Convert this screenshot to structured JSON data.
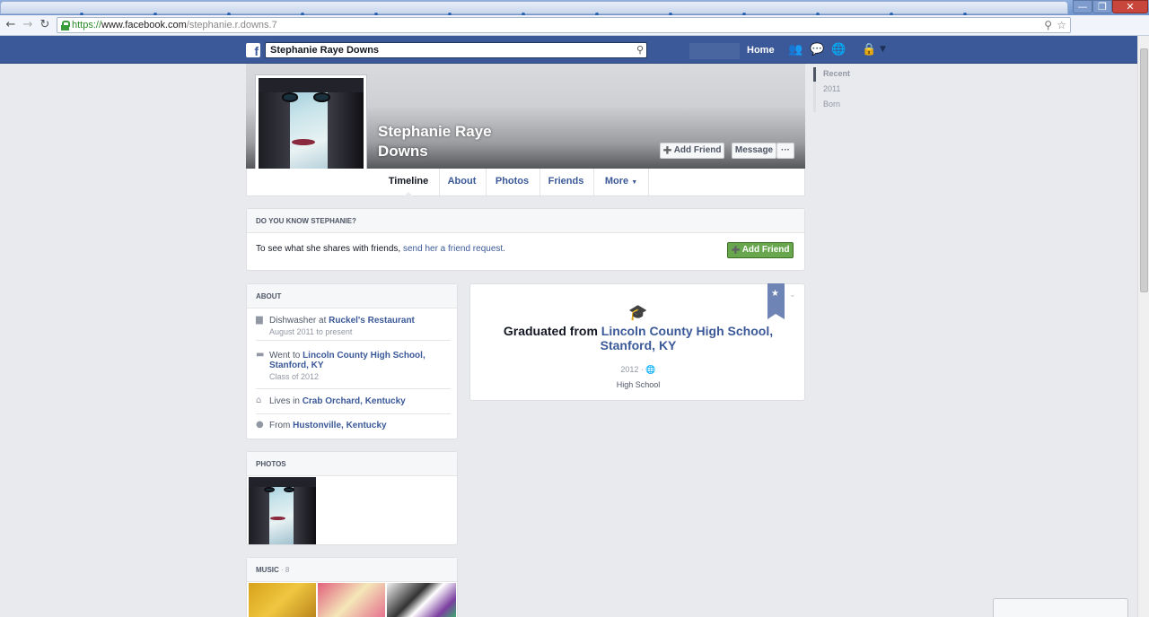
{
  "browser": {
    "url_protocol": "https://",
    "url_host": "www.facebook.com",
    "url_path": "/stephanie.r.downs.7",
    "window_buttons": [
      "—",
      "❐",
      "✕"
    ]
  },
  "fb_header": {
    "logo": "f",
    "search_value": "Stephanie Raye Downs",
    "home_label": "Home"
  },
  "profile": {
    "name_line1": "Stephanie Raye",
    "name_line2": "Downs",
    "add_friend_label": "Add Friend",
    "message_label": "Message",
    "more_actions_label": "···"
  },
  "tabs": {
    "timeline": "Timeline",
    "about": "About",
    "photos": "Photos",
    "friends": "Friends",
    "more": "More"
  },
  "know_card": {
    "heading": "DO YOU KNOW STEPHANIE?",
    "text": "To see what she shares with friends,",
    "link": "send her a friend request.",
    "button": "Add Friend"
  },
  "about": {
    "heading": "ABOUT",
    "work_prefix": "Dishwasher at ",
    "work_place": "Ruckel's Restaurant",
    "work_sub": "August 2011 to present",
    "school_prefix": "Went to ",
    "school_place": "Lincoln County High School, Stanford, KY",
    "school_sub": "Class of 2012",
    "lives_prefix": "Lives in ",
    "lives_place": "Crab Orchard, Kentucky",
    "from_prefix": "From ",
    "from_place": "Hustonville, Kentucky"
  },
  "photos_card": {
    "heading": "PHOTOS"
  },
  "music_card": {
    "heading": "MUSIC",
    "count": "· 8"
  },
  "event": {
    "prefix": "Graduated from ",
    "school": "Lincoln County High School, Stanford, KY",
    "year": "2012",
    "type": "High School"
  },
  "timeline_nav": {
    "items": [
      "Recent",
      "2011",
      "Born"
    ]
  },
  "colors": {
    "fb_blue": "#3b5998",
    "green_button": "#69a74e",
    "background": "#e9eaed"
  }
}
